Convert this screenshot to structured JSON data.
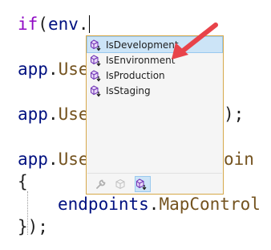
{
  "code": {
    "line1": {
      "keyword": "if",
      "open": "(",
      "var": "env",
      "dot": "."
    },
    "line2": {
      "obj": "app",
      "dot": ".",
      "member": "Use"
    },
    "line3": {
      "obj": "app",
      "dot": ".",
      "member": "Use",
      "tail": ");"
    },
    "line4": {
      "obj": "app",
      "dot": ".",
      "member": "Use",
      "tail": "oin"
    },
    "line5": {
      "brace": "{"
    },
    "line6": {
      "obj": "endpoints",
      "dot": ".",
      "method": "MapControl"
    },
    "line7": {
      "close": "});"
    }
  },
  "completion": {
    "items": [
      {
        "label": "IsDevelopment",
        "icon": "extension-method-icon",
        "selected": true
      },
      {
        "label": "IsEnvironment",
        "icon": "extension-method-icon",
        "selected": false
      },
      {
        "label": "IsProduction",
        "icon": "extension-method-icon",
        "selected": false
      },
      {
        "label": "IsStaging",
        "icon": "extension-method-icon",
        "selected": false
      }
    ],
    "filters": [
      {
        "name": "wrench-filter-icon",
        "active": false
      },
      {
        "name": "cube-filter-icon",
        "active": false
      },
      {
        "name": "extension-method-filter-icon",
        "active": true
      }
    ]
  },
  "colors": {
    "keyword": "#8f08c4",
    "identifier": "#001080",
    "method": "#74531f",
    "selection": "#cce4f7",
    "popup_border": "#d6a84a",
    "arrow": "#e8434a"
  }
}
